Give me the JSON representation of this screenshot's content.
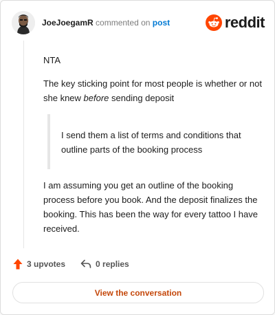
{
  "header": {
    "username": "JoeJoegamR",
    "action": "commented on",
    "post_link": "post",
    "logo_text": "reddit"
  },
  "comment": {
    "paragraph_1": "NTA",
    "paragraph_2_before": "The key sticking point for most people is whether or not she knew ",
    "paragraph_2_em": "before",
    "paragraph_2_after": " sending deposit",
    "quote": "I send them a list of terms and conditions that outline parts of the booking process",
    "paragraph_3": "I am assuming you get an outline of the booking process before you book. And the deposit finalizes the booking. This has been the way for every tattoo I have received."
  },
  "footer": {
    "upvotes": "3 upvotes",
    "replies": "0 replies"
  },
  "cta": {
    "label": "View the conversation"
  },
  "colors": {
    "brand": "#ff4500",
    "link": "#0079d3",
    "cta_text": "#c4470a"
  },
  "icons": [
    "avatar",
    "reddit-logo-icon",
    "upvote-arrow-icon",
    "reply-arrow-icon"
  ]
}
